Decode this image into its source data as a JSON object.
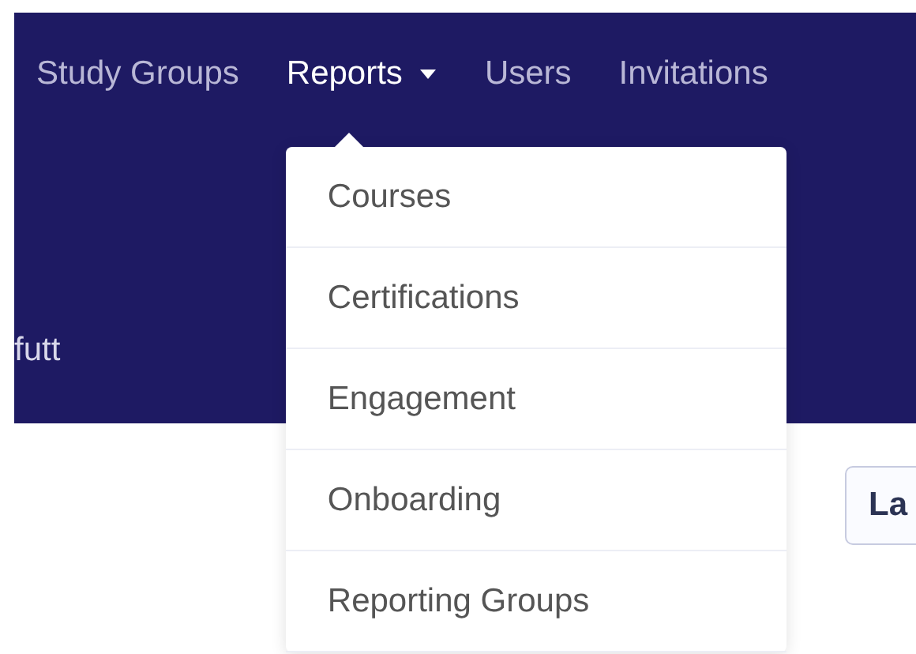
{
  "nav": {
    "items": [
      {
        "label": "Study Groups",
        "selected": false,
        "dropdown": false
      },
      {
        "label": "Reports",
        "selected": true,
        "dropdown": true
      },
      {
        "label": "Users",
        "selected": false,
        "dropdown": false
      },
      {
        "label": "Invitations",
        "selected": false,
        "dropdown": false
      }
    ]
  },
  "dropdown": {
    "expanded": true,
    "items": [
      "Courses",
      "Certifications",
      "Engagement",
      "Onboarding",
      "Reporting Groups"
    ]
  },
  "header_text": "futt",
  "button": {
    "label": "La"
  }
}
